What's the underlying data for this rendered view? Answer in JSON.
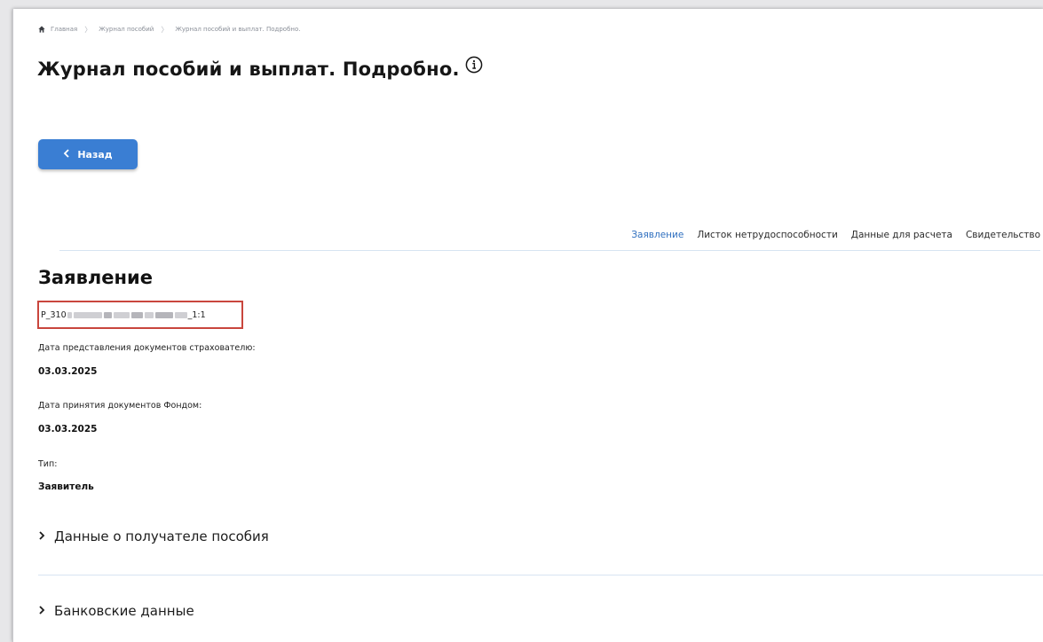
{
  "breadcrumb": {
    "items": [
      "Главная",
      "Журнал пособий",
      "Журнал пособий и выплат. Подробно."
    ]
  },
  "page": {
    "title": "Журнал пособий и выплат. Подробно."
  },
  "back_button": {
    "label": "Назад"
  },
  "tabs": [
    {
      "label": "Заявление",
      "active": true
    },
    {
      "label": "Листок нетрудоспособности",
      "active": false
    },
    {
      "label": "Данные для расчета",
      "active": false
    },
    {
      "label": "Свидетельство",
      "active": false
    }
  ],
  "section": {
    "title": "Заявление",
    "id_prefix": "P_310",
    "id_suffix": "_1:1",
    "fields": [
      {
        "label": "Дата представления документов страхователю:",
        "value": "03.03.2025"
      },
      {
        "label": "Дата принятия документов Фондом:",
        "value": "03.03.2025"
      },
      {
        "label": "Тип:",
        "value": "Заявитель"
      }
    ]
  },
  "accordions": [
    {
      "label": "Данные о получателе пособия"
    },
    {
      "label": "Банковские данные"
    }
  ],
  "colors": {
    "accent": "#3a7ed3",
    "active_tab": "#2f6fbf",
    "highlight_border": "#c9463d"
  },
  "icons": [
    "home-icon",
    "info-icon",
    "chevron-left-icon",
    "chevron-right-icon"
  ]
}
